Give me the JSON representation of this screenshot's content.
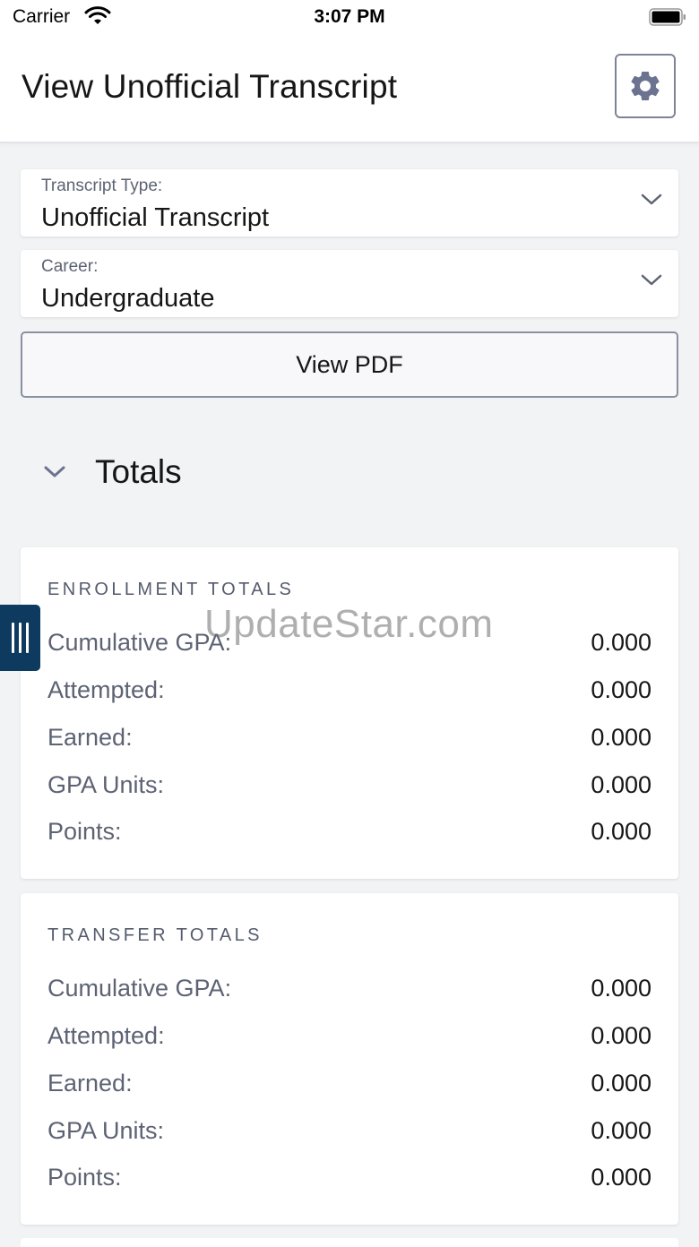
{
  "status_bar": {
    "carrier": "Carrier",
    "time": "3:07 PM"
  },
  "header": {
    "title": "View Unofficial Transcript",
    "settings_icon": "gear-icon"
  },
  "filters": {
    "transcript_type": {
      "label": "Transcript Type:",
      "value": "Unofficial Transcript"
    },
    "career": {
      "label": "Career:",
      "value": "Undergraduate"
    }
  },
  "view_pdf_label": "View PDF",
  "totals": {
    "title": "Totals",
    "enrollment": {
      "heading": "ENROLLMENT TOTALS",
      "rows": [
        {
          "label": "Cumulative GPA:",
          "value": "0.000"
        },
        {
          "label": "Attempted:",
          "value": "0.000"
        },
        {
          "label": "Earned:",
          "value": "0.000"
        },
        {
          "label": "GPA Units:",
          "value": "0.000"
        },
        {
          "label": "Points:",
          "value": "0.000"
        }
      ]
    },
    "transfer": {
      "heading": "TRANSFER TOTALS",
      "rows": [
        {
          "label": "Cumulative GPA:",
          "value": "0.000"
        },
        {
          "label": "Attempted:",
          "value": "0.000"
        },
        {
          "label": "Earned:",
          "value": "0.000"
        },
        {
          "label": "GPA Units:",
          "value": "0.000"
        },
        {
          "label": "Points:",
          "value": "0.000"
        }
      ]
    }
  },
  "watermark": "UpdateStar.com",
  "colors": {
    "accent": "#6b7391",
    "side_tab": "#0e3a5f",
    "background": "#f2f3f5"
  }
}
